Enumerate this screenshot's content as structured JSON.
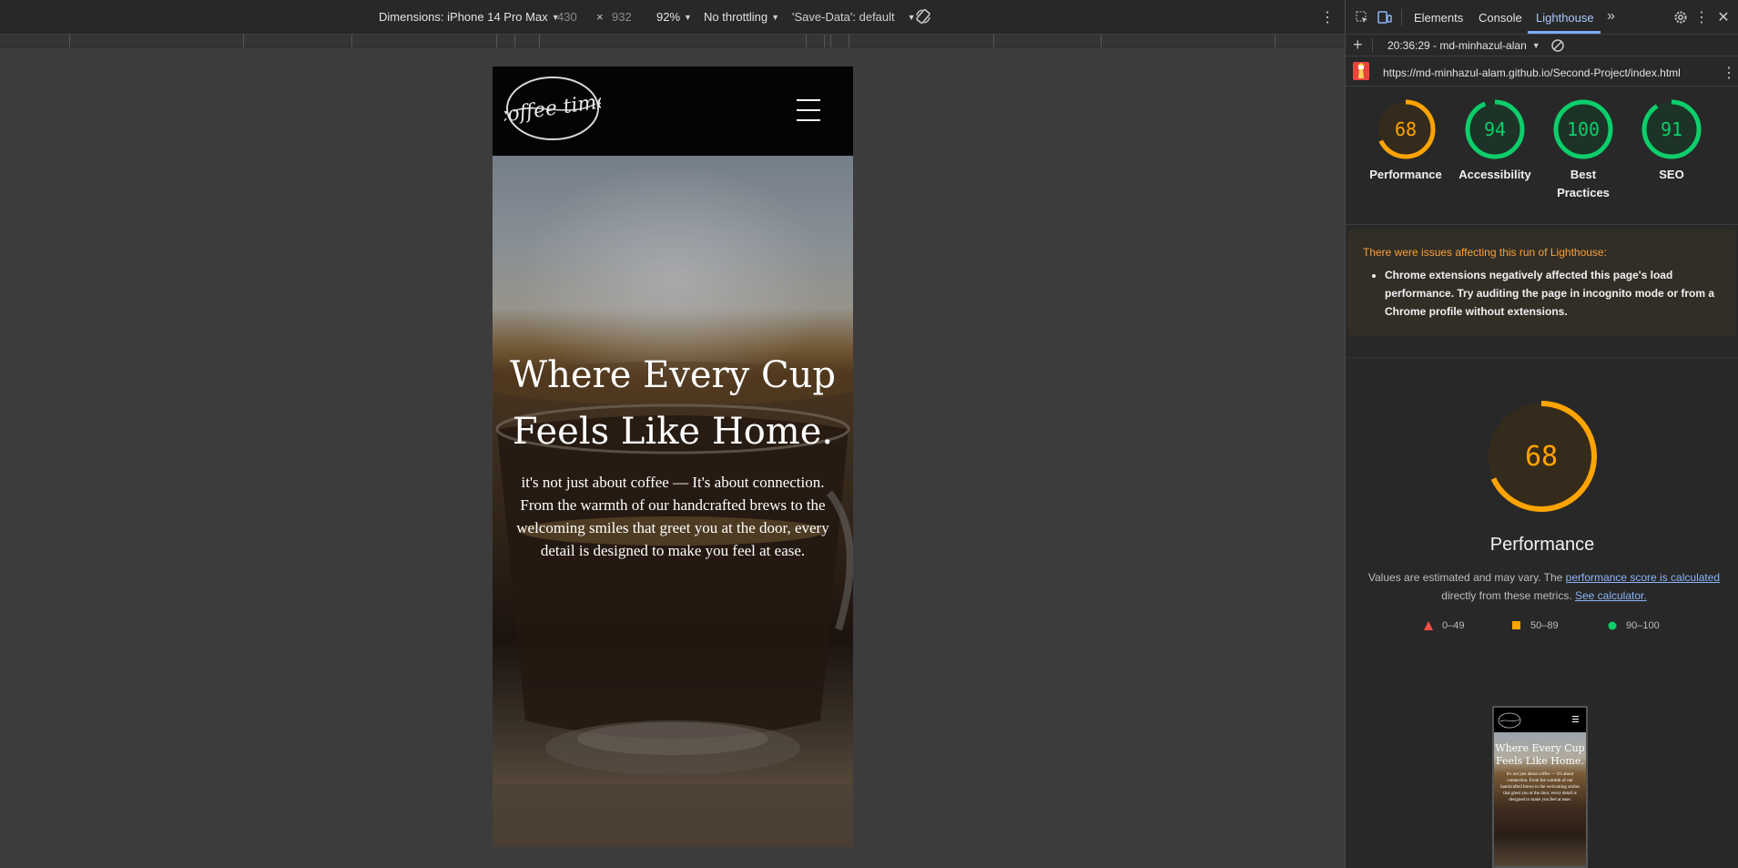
{
  "device_toolbar": {
    "dimensions_label": "Dimensions: iPhone 14 Pro Max",
    "width": "430",
    "times": "×",
    "height": "932",
    "zoom": "92%",
    "throttling": "No throttling",
    "save_data": "'Save-Data': default"
  },
  "page": {
    "logo_text": "coffee time",
    "hero_title": "Where Every Cup Feels Like Home.",
    "hero_text": "it's not just about coffee — It's about connection. From the warmth of our handcrafted brews to the welcoming smiles that greet you at the door, every detail is designed to make you feel at ease."
  },
  "devtools": {
    "tabs": [
      "Elements",
      "Console",
      "Lighthouse"
    ],
    "active_tab": "Lighthouse",
    "more_tabs": "»",
    "report_time": "20:36:29 - md-minhazul-alan",
    "url": "https://md-minhazul-alam.github.io/Second-Project/index.html"
  },
  "scores": [
    {
      "label": "Performance",
      "value": 68,
      "color": "#ffa400"
    },
    {
      "label": "Accessibility",
      "value": 94,
      "color": "#0cce6b"
    },
    {
      "label": "Best Practices",
      "value": 100,
      "color": "#0cce6b"
    },
    {
      "label": "SEO",
      "value": 91,
      "color": "#0cce6b"
    }
  ],
  "warning": {
    "title": "There were issues affecting this run of Lighthouse:",
    "items": [
      "Chrome extensions negatively affected this page's load performance. Try auditing the page in incognito mode or from a Chrome profile without extensions."
    ]
  },
  "performance": {
    "score": 68,
    "title": "Performance",
    "desc_prefix": "Values are estimated and may vary. The ",
    "desc_link": "performance score is calculated",
    "desc_middle": " directly from these metrics. ",
    "calc_link": "See calculator."
  },
  "legend": [
    {
      "range": "0–49",
      "color": "#ff4e42",
      "shape": "triangle"
    },
    {
      "range": "50–89",
      "color": "#ffa400",
      "shape": "square"
    },
    {
      "range": "90–100",
      "color": "#0cce6b",
      "shape": "circle"
    }
  ],
  "thumbnail": {
    "title": "Where Every Cup Feels Like Home.",
    "text": "it's not just about coffee — It's about connection. From the warmth of our handcrafted brews to the welcoming smiles that greet you at the door, every detail is designed to make you feel at ease."
  }
}
